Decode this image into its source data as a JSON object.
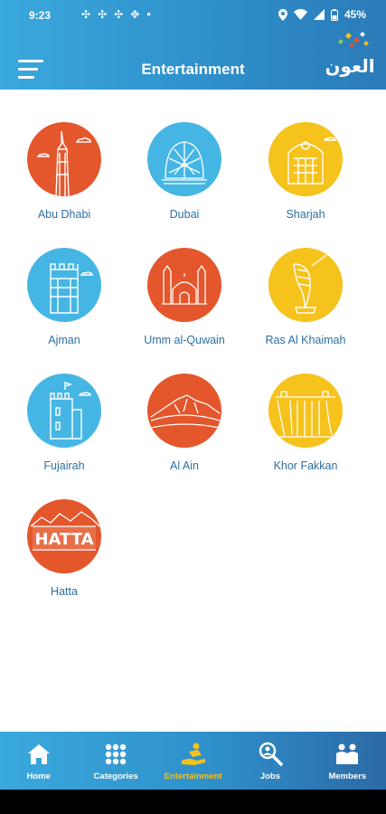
{
  "status_bar": {
    "time": "9:23",
    "battery": "45%"
  },
  "header": {
    "title": "Entertainment",
    "logo_text": "العون"
  },
  "colors": {
    "header": "#2f8fca",
    "orange": "#e4562b",
    "blue": "#45b6e4",
    "yellow": "#f6c21c",
    "active": "#f6c21c"
  },
  "emirates": [
    {
      "label": "Abu Dhabi",
      "color": "orange",
      "icon": "burj-tower-icon"
    },
    {
      "label": "Dubai",
      "color": "blue",
      "icon": "dome-building-icon"
    },
    {
      "label": "Sharjah",
      "color": "yellow",
      "icon": "arch-building-icon"
    },
    {
      "label": "Ajman",
      "color": "blue",
      "icon": "fort-tower-icon"
    },
    {
      "label": "Umm al-Quwain",
      "color": "orange",
      "icon": "mosque-icon"
    },
    {
      "label": "Ras Al Khaimah",
      "color": "yellow",
      "icon": "sail-monument-icon"
    },
    {
      "label": "Fujairah",
      "color": "blue",
      "icon": "watch-tower-icon"
    },
    {
      "label": "Al Ain",
      "color": "orange",
      "icon": "mountain-icon"
    },
    {
      "label": "Khor Fakkan",
      "color": "yellow",
      "icon": "waterfall-icon"
    },
    {
      "label": "Hatta",
      "color": "orange",
      "icon": "hatta-sign-icon",
      "sign_text": "HATTA"
    }
  ],
  "bottom_nav": [
    {
      "label": "Home",
      "icon": "home-icon",
      "active": false
    },
    {
      "label": "Categories",
      "icon": "grid-icon",
      "active": false
    },
    {
      "label": "Entertainment",
      "icon": "entertainment-icon",
      "active": true
    },
    {
      "label": "Jobs",
      "icon": "job-search-icon",
      "active": false
    },
    {
      "label": "Members",
      "icon": "members-icon",
      "active": false
    }
  ]
}
